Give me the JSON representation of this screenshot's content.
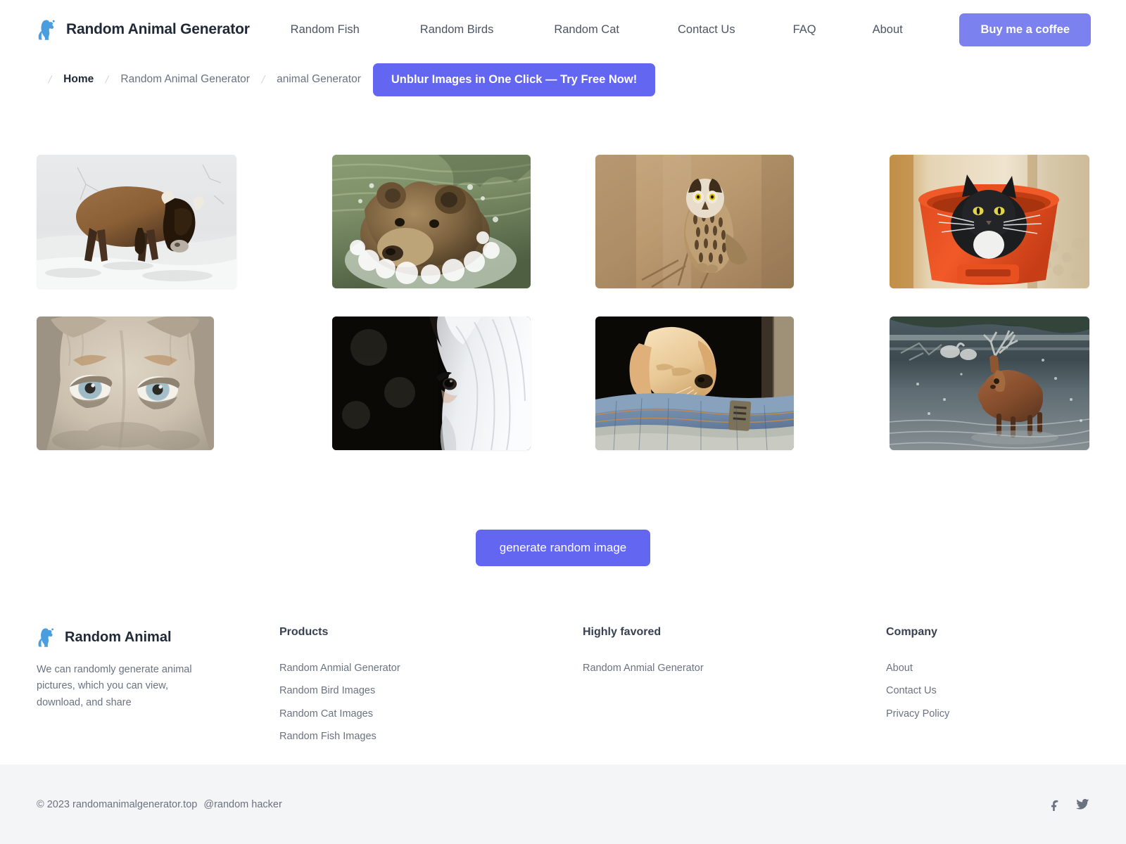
{
  "header": {
    "logo_icon": "squirrel-icon",
    "brand": "Random Animal Generator",
    "nav": [
      {
        "label": "Random Fish"
      },
      {
        "label": "Random Birds"
      },
      {
        "label": "Random Cat"
      },
      {
        "label": "Contact Us"
      },
      {
        "label": "FAQ"
      },
      {
        "label": "About"
      }
    ],
    "cta": "Buy me a coffee"
  },
  "breadcrumb": {
    "separator": "/",
    "items": [
      {
        "label": "Home",
        "current": true
      },
      {
        "label": "Random Animal Generator",
        "current": false
      },
      {
        "label": "animal Generator",
        "current": false
      }
    ],
    "promo_button": "Unblur Images in One Click — Try Free Now!"
  },
  "gallery": {
    "rows": [
      [
        {
          "alt": "bison-in-snow"
        },
        {
          "alt": "brown-bear-swimming"
        },
        {
          "alt": "short-eared-owl-perched"
        },
        {
          "alt": "black-cat-in-orange-bucket"
        }
      ],
      [
        {
          "alt": "lioness-close-up-eyes"
        },
        {
          "alt": "white-horse-in-dark"
        },
        {
          "alt": "labrador-puppy-in-jeans"
        },
        {
          "alt": "red-deer-stag-in-water"
        }
      ]
    ]
  },
  "actions": {
    "generate": "generate random image"
  },
  "footer": {
    "brand": "Random Animal",
    "logo_icon": "squirrel-icon",
    "description": "We can randomly generate animal pictures, which you can view, download, and share",
    "columns": [
      {
        "heading": "Products",
        "links": [
          "Random Anmial Generator",
          "Random Bird Images",
          "Random Cat Images",
          "Random Fish Images"
        ]
      },
      {
        "heading": "Highly favored",
        "links": [
          "Random Anmial Generator"
        ]
      },
      {
        "heading": "Company",
        "links": [
          "About",
          "Contact Us",
          "Privacy Policy"
        ]
      }
    ]
  },
  "bottom": {
    "copyright": "© 2023 randomanimalgenerator.top",
    "handle": "@random hacker",
    "socials": [
      {
        "name": "facebook-icon"
      },
      {
        "name": "twitter-icon"
      }
    ]
  },
  "colors": {
    "accent": "#6366f1",
    "accent_light": "#7b82ef",
    "logo_blue": "#4a9ee0",
    "text_dark": "#1f2937",
    "text_muted": "#6b7280",
    "bottom_bar_bg": "#f4f5f7"
  }
}
